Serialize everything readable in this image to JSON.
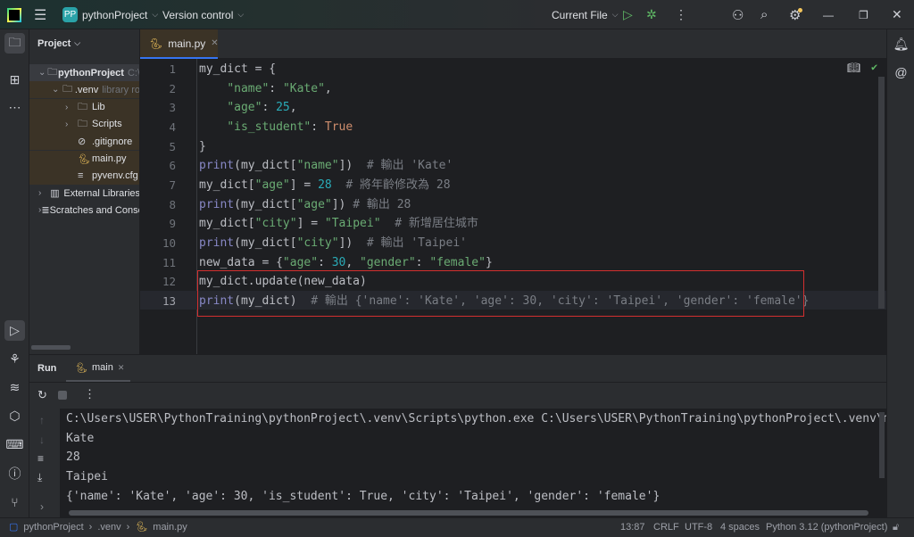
{
  "titlebar": {
    "project_badge": "PP",
    "project": "pythonProject",
    "vcs": "Version control",
    "run_config": "Current File"
  },
  "project_panel": {
    "title": "Project",
    "tree": [
      {
        "label": "pythonProject",
        "hint": "C:\\",
        "indent": 0,
        "arrow": "⌄",
        "icon": "folder-icon"
      },
      {
        "label": ".venv",
        "hint": "library ro",
        "indent": 1,
        "arrow": "⌄",
        "icon": "folder-icon"
      },
      {
        "label": "Lib",
        "hint": "",
        "indent": 2,
        "arrow": "›",
        "icon": "folder-icon"
      },
      {
        "label": "Scripts",
        "hint": "",
        "indent": 2,
        "arrow": "›",
        "icon": "folder-icon"
      },
      {
        "label": ".gitignore",
        "hint": "",
        "indent": 2,
        "arrow": "",
        "icon": "ignore-file-icon"
      },
      {
        "label": "main.py",
        "hint": "",
        "indent": 2,
        "arrow": "",
        "icon": "python-file-icon"
      },
      {
        "label": "pyvenv.cfg",
        "hint": "",
        "indent": 2,
        "arrow": "",
        "icon": "text-file-icon"
      },
      {
        "label": "External Libraries",
        "hint": "",
        "indent": 0,
        "arrow": "›",
        "icon": "library-icon"
      },
      {
        "label": "Scratches and Consoles",
        "hint": "",
        "indent": 0,
        "arrow": "›",
        "icon": "scratches-icon"
      }
    ]
  },
  "editor": {
    "tab": "main.py",
    "lines": [
      [
        {
          "t": "my_dict = {"
        }
      ],
      [
        {
          "t": "    "
        },
        {
          "t": "\"name\"",
          "c": "s"
        },
        {
          "t": ": "
        },
        {
          "t": "\"Kate\"",
          "c": "s"
        },
        {
          "t": ","
        }
      ],
      [
        {
          "t": "    "
        },
        {
          "t": "\"age\"",
          "c": "s"
        },
        {
          "t": ": "
        },
        {
          "t": "25",
          "c": "n"
        },
        {
          "t": ","
        }
      ],
      [
        {
          "t": "    "
        },
        {
          "t": "\"is_student\"",
          "c": "s"
        },
        {
          "t": ": "
        },
        {
          "t": "True",
          "c": "b"
        }
      ],
      [
        {
          "t": "}"
        }
      ],
      [
        {
          "t": "print",
          "c": "k"
        },
        {
          "t": "(my_dict["
        },
        {
          "t": "\"name\"",
          "c": "s"
        },
        {
          "t": "])  "
        },
        {
          "t": "# 輸出 'Kate'",
          "c": "c"
        }
      ],
      [
        {
          "t": "my_dict["
        },
        {
          "t": "\"age\"",
          "c": "s"
        },
        {
          "t": "] = "
        },
        {
          "t": "28",
          "c": "n"
        },
        {
          "t": "  "
        },
        {
          "t": "# 將年齡修改為 28",
          "c": "c"
        }
      ],
      [
        {
          "t": "print",
          "c": "k"
        },
        {
          "t": "(my_dict["
        },
        {
          "t": "\"age\"",
          "c": "s"
        },
        {
          "t": "]) "
        },
        {
          "t": "# 輸出 28",
          "c": "c"
        }
      ],
      [
        {
          "t": "my_dict["
        },
        {
          "t": "\"city\"",
          "c": "s"
        },
        {
          "t": "] = "
        },
        {
          "t": "\"Taipei\"",
          "c": "s"
        },
        {
          "t": "  "
        },
        {
          "t": "# 新增居住城市",
          "c": "c"
        }
      ],
      [
        {
          "t": "print",
          "c": "k"
        },
        {
          "t": "(my_dict["
        },
        {
          "t": "\"city\"",
          "c": "s"
        },
        {
          "t": "])  "
        },
        {
          "t": "# 輸出 'Taipei'",
          "c": "c"
        }
      ],
      [
        {
          "t": "new_data = {"
        },
        {
          "t": "\"age\"",
          "c": "s"
        },
        {
          "t": ": "
        },
        {
          "t": "30",
          "c": "n"
        },
        {
          "t": ", "
        },
        {
          "t": "\"gender\"",
          "c": "s"
        },
        {
          "t": ": "
        },
        {
          "t": "\"female\"",
          "c": "s"
        },
        {
          "t": "}"
        }
      ],
      [
        {
          "t": "my_dict.update(new_data)"
        }
      ],
      [
        {
          "t": "print",
          "c": "k"
        },
        {
          "t": "(my_dict)  "
        },
        {
          "t": "# 輸出 {'name': 'Kate', 'age': 30, 'city': 'Taipei', 'gender': 'female'}",
          "c": "c"
        }
      ]
    ],
    "highlight_color": "#d32f2f"
  },
  "run": {
    "title": "Run",
    "tab": "main",
    "output": [
      "C:\\Users\\USER\\PythonTraining\\pythonProject\\.venv\\Scripts\\python.exe C:\\Users\\USER\\PythonTraining\\pythonProject\\.venv\\main.py",
      "Kate",
      "28",
      "Taipei",
      "{'name': 'Kate', 'age': 30, 'is_student': True, 'city': 'Taipei', 'gender': 'female'}"
    ]
  },
  "status": {
    "breadcrumb": [
      "pythonProject",
      ".venv",
      "main.py"
    ],
    "position": "13:87",
    "line_sep": "CRLF",
    "encoding": "UTF-8",
    "indent": "4 spaces",
    "interpreter": "Python 3.12 (pythonProject)"
  }
}
